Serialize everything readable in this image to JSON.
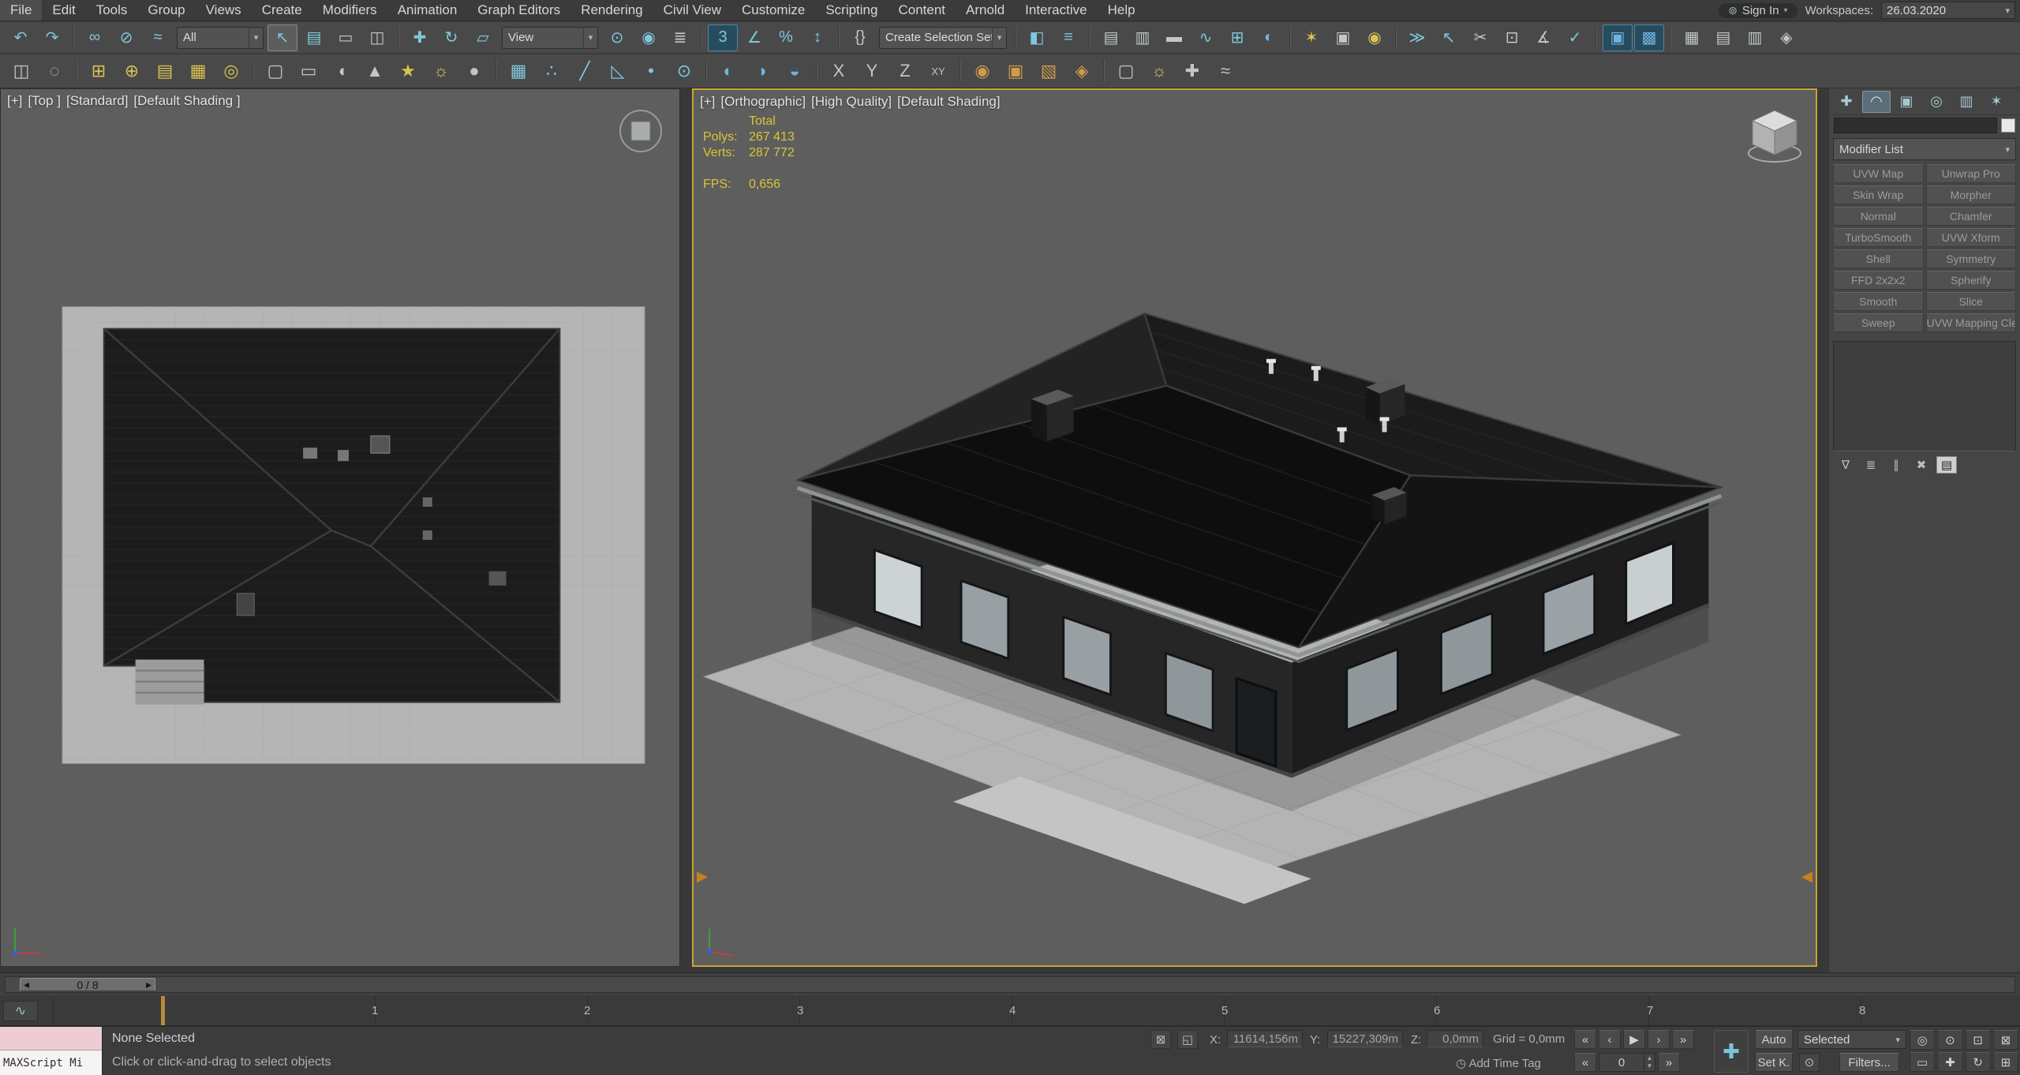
{
  "colors": {
    "active_viewport_border": "#c9a42f",
    "stats_text": "#d6c832",
    "toolbar_active_blue": "#274c5e",
    "maxscript_pink": "#edccd4"
  },
  "menu": {
    "items": [
      {
        "l": "File",
        "n": "menu-file"
      },
      {
        "l": "Edit",
        "n": "menu-edit"
      },
      {
        "l": "Tools",
        "n": "menu-tools"
      },
      {
        "l": "Group",
        "n": "menu-group"
      },
      {
        "l": "Views",
        "n": "menu-views"
      },
      {
        "l": "Create",
        "n": "menu-create"
      },
      {
        "l": "Modifiers",
        "n": "menu-modifiers"
      },
      {
        "l": "Animation",
        "n": "menu-animation"
      },
      {
        "l": "Graph Editors",
        "n": "menu-graph-editors"
      },
      {
        "l": "Rendering",
        "n": "menu-rendering"
      },
      {
        "l": "Civil View",
        "n": "menu-civil-view"
      },
      {
        "l": "Customize",
        "n": "menu-customize"
      },
      {
        "l": "Scripting",
        "n": "menu-scripting"
      },
      {
        "l": "Content",
        "n": "menu-content"
      },
      {
        "l": "Arnold",
        "n": "menu-arnold"
      },
      {
        "l": "Interactive",
        "n": "menu-interactive"
      },
      {
        "l": "Help",
        "n": "menu-help"
      }
    ],
    "sign_in": "Sign In",
    "sign_in_caret": "▾",
    "person_glyph": "⊚",
    "workspaces_label": "Workspaces:",
    "workspace_value": "26.03.2020",
    "workspace_caret": "▾"
  },
  "toolbar_row1": [
    {
      "t": "i",
      "n": "undo-icon",
      "g": "↶",
      "c": "teal"
    },
    {
      "t": "i",
      "n": "redo-icon",
      "g": "↷",
      "c": "teal"
    },
    {
      "t": "s"
    },
    {
      "t": "i",
      "n": "select-and-link-icon",
      "g": "∞",
      "c": "teal"
    },
    {
      "t": "i",
      "n": "unlink-selection-icon",
      "g": "⊘",
      "c": "teal"
    },
    {
      "t": "i",
      "n": "bind-to-space-warp-icon",
      "g": "≈",
      "c": "teal"
    },
    {
      "t": "dd",
      "n": "selection-filter-dropdown",
      "v": "All",
      "c": "dd-all"
    },
    {
      "t": "i",
      "n": "select-object-icon",
      "g": "↖",
      "c": "teal on"
    },
    {
      "t": "i",
      "n": "select-by-name-icon",
      "g": "▤",
      "c": "teal"
    },
    {
      "t": "i",
      "n": "rectangular-selection-region-icon",
      "g": "▭",
      "c": "gray"
    },
    {
      "t": "i",
      "n": "window-crossing-icon",
      "g": "◫",
      "c": "gray"
    },
    {
      "t": "s"
    },
    {
      "t": "i",
      "n": "select-and-move-icon",
      "g": "✚",
      "c": "teal"
    },
    {
      "t": "i",
      "n": "select-and-rotate-icon",
      "g": "↻",
      "c": "teal"
    },
    {
      "t": "i",
      "n": "select-and-scale-icon",
      "g": "▱",
      "c": "teal"
    },
    {
      "t": "dd",
      "n": "reference-coordinate-dropdown",
      "v": "View",
      "c": "dd-view"
    },
    {
      "t": "i",
      "n": "use-pivot-point-center-icon",
      "g": "⊙",
      "c": "teal"
    },
    {
      "t": "i",
      "n": "select-and-manipulate-icon",
      "g": "◉",
      "c": "teal"
    },
    {
      "t": "i",
      "n": "keyboard-shortcut-override-icon",
      "g": "≣",
      "c": "gray"
    },
    {
      "t": "s"
    },
    {
      "t": "i",
      "n": "snap-toggle-3d-icon",
      "g": "3",
      "c": "teal act"
    },
    {
      "t": "i",
      "n": "angle-snap-icon",
      "g": "∠",
      "c": "teal"
    },
    {
      "t": "i",
      "n": "percent-snap-icon",
      "g": "%",
      "c": "teal"
    },
    {
      "t": "i",
      "n": "spinner-snap-icon",
      "g": "↕",
      "c": "teal"
    },
    {
      "t": "s"
    },
    {
      "t": "i",
      "n": "edit-named-selection-sets-icon",
      "g": "{}",
      "c": "gray"
    },
    {
      "t": "dd",
      "n": "named-selection-set-combo",
      "v": "Create Selection Set",
      "c": "dd-sel"
    },
    {
      "t": "s"
    },
    {
      "t": "i",
      "n": "mirror-icon",
      "g": "◧",
      "c": "teal"
    },
    {
      "t": "i",
      "n": "align-icon",
      "g": "≡",
      "c": "teal"
    },
    {
      "t": "s"
    },
    {
      "t": "i",
      "n": "scene-explorer-toggle-icon",
      "g": "▤",
      "c": "gray"
    },
    {
      "t": "i",
      "n": "layer-explorer-toggle-icon",
      "g": "▥",
      "c": "gray"
    },
    {
      "t": "i",
      "n": "ribbon-toggle-icon",
      "g": "▬",
      "c": "gray"
    },
    {
      "t": "i",
      "n": "curve-editor-icon",
      "g": "∿",
      "c": "teal"
    },
    {
      "t": "i",
      "n": "schematic-view-icon",
      "g": "⊞",
      "c": "teal"
    },
    {
      "t": "i",
      "n": "material-editor-icon",
      "g": "◐",
      "c": "blue"
    },
    {
      "t": "s"
    },
    {
      "t": "i",
      "n": "render-setup-icon",
      "g": "✶",
      "c": "yellow"
    },
    {
      "t": "i",
      "n": "rendered-frame-window-icon",
      "g": "▣",
      "c": "gray"
    },
    {
      "t": "i",
      "n": "render-production-icon",
      "g": "◉",
      "c": "yellow"
    },
    {
      "t": "s"
    },
    {
      "t": "i",
      "n": "toolbar-overflow-icon",
      "g": "≫",
      "c": "teal"
    },
    {
      "t": "i",
      "n": "select-similar-icon",
      "g": "↖",
      "c": "teal"
    },
    {
      "t": "i",
      "n": "cut-geometry-icon",
      "g": "✂",
      "c": "gray"
    },
    {
      "t": "i",
      "n": "paste-icon",
      "g": "⊡",
      "c": "gray"
    },
    {
      "t": "i",
      "n": "measure-ang-icon",
      "g": "∡",
      "c": "gray"
    },
    {
      "t": "i",
      "n": "validate-icon",
      "g": "✓",
      "c": "teal"
    },
    {
      "t": "s"
    },
    {
      "t": "i",
      "n": "activeshade-viewport-icon",
      "g": "▣",
      "c": "blue act"
    },
    {
      "t": "i",
      "n": "viewport-canvas-icon",
      "g": "▩",
      "c": "blue act"
    },
    {
      "t": "s"
    },
    {
      "t": "i",
      "n": "grid-settings-icon",
      "g": "▦",
      "c": "gray"
    },
    {
      "t": "i",
      "n": "array-tool-icon",
      "g": "▤",
      "c": "gray"
    },
    {
      "t": "i",
      "n": "spacing-tool-icon",
      "g": "▥",
      "c": "gray"
    },
    {
      "t": "i",
      "n": "mcg-icon",
      "g": "◈",
      "c": "gray"
    }
  ],
  "toolbar_row2": [
    {
      "t": "i",
      "n": "viewport-layout-tabs-icon",
      "g": "◫",
      "c": "gray"
    },
    {
      "t": "i",
      "n": "show-ghosting-icon",
      "g": "◌",
      "c": "gray"
    },
    {
      "t": "s"
    },
    {
      "t": "i",
      "n": "create-layer-icon",
      "g": "⊞",
      "c": "yellow"
    },
    {
      "t": "i",
      "n": "add-selection-to-layer-icon",
      "g": "⊕",
      "c": "yellow"
    },
    {
      "t": "i",
      "n": "layer-list-icon",
      "g": "▤",
      "c": "yellow"
    },
    {
      "t": "i",
      "n": "select-objects-in-layer-icon",
      "g": "▦",
      "c": "yellow"
    },
    {
      "t": "i",
      "n": "set-current-layer-icon",
      "g": "◎",
      "c": "yellow"
    },
    {
      "t": "s"
    },
    {
      "t": "i",
      "n": "rounded-rect-primitive-icon",
      "g": "▢",
      "c": "gray"
    },
    {
      "t": "i",
      "n": "capsule-primitive-icon",
      "g": "▭",
      "c": "gray"
    },
    {
      "t": "i",
      "n": "oiltank-primitive-icon",
      "g": "◖",
      "c": "gray"
    },
    {
      "t": "i",
      "n": "cone-primitive-icon",
      "g": "▲",
      "c": "gray"
    },
    {
      "t": "i",
      "n": "star-shape-icon",
      "g": "★",
      "c": "yellow"
    },
    {
      "t": "i",
      "n": "sun-light-icon",
      "g": "☼",
      "c": "yellow"
    },
    {
      "t": "i",
      "n": "sphere-primitive-icon",
      "g": "●",
      "c": "gray"
    },
    {
      "t": "s"
    },
    {
      "t": "i",
      "n": "snap-grid-points-icon",
      "g": "▦",
      "c": "teal"
    },
    {
      "t": "i",
      "n": "snap-vertex-icon",
      "g": "∴",
      "c": "teal"
    },
    {
      "t": "i",
      "n": "snap-edge-icon",
      "g": "╱",
      "c": "teal"
    },
    {
      "t": "i",
      "n": "snap-face-icon",
      "g": "◺",
      "c": "teal"
    },
    {
      "t": "i",
      "n": "snap-midpoint-icon",
      "g": "•",
      "c": "teal"
    },
    {
      "t": "i",
      "n": "snap-pivot-icon",
      "g": "⊙",
      "c": "teal"
    },
    {
      "t": "s"
    },
    {
      "t": "i",
      "n": "render-production-shortcut-icon",
      "g": "◐",
      "c": "blue"
    },
    {
      "t": "i",
      "n": "render-iterative-icon",
      "g": "◑",
      "c": "blue"
    },
    {
      "t": "i",
      "n": "activeshade-icon",
      "g": "◒",
      "c": "blue"
    },
    {
      "t": "s"
    },
    {
      "t": "i",
      "n": "axis-x-constraint-icon",
      "g": "X",
      "c": "gray"
    },
    {
      "t": "i",
      "n": "axis-y-constraint-icon",
      "g": "Y",
      "c": "gray"
    },
    {
      "t": "i",
      "n": "axis-z-constraint-icon",
      "g": "Z",
      "c": "gray"
    },
    {
      "t": "i",
      "n": "plane-xy-constraint-icon",
      "g": "XY",
      "c": "gray sm"
    },
    {
      "t": "s"
    },
    {
      "t": "i",
      "n": "massfx-world-icon",
      "g": "◉",
      "c": "orange"
    },
    {
      "t": "i",
      "n": "rigid-body-icon",
      "g": "▣",
      "c": "orange"
    },
    {
      "t": "i",
      "n": "mcloth-icon",
      "g": "▧",
      "c": "orange"
    },
    {
      "t": "i",
      "n": "ragdoll-icon",
      "g": "◈",
      "c": "orange"
    },
    {
      "t": "s"
    },
    {
      "t": "i",
      "n": "camera-create-icon",
      "g": "▢",
      "c": "gray"
    },
    {
      "t": "i",
      "n": "light-create-icon",
      "g": "☼",
      "c": "yellow"
    },
    {
      "t": "i",
      "n": "helper-create-icon",
      "g": "✚",
      "c": "gray"
    },
    {
      "t": "i",
      "n": "space-warp-create-icon",
      "g": "≈",
      "c": "gray"
    }
  ],
  "viewports": {
    "left": {
      "label": [
        {
          "l": "[+]",
          "n": "vp-left-general-menu"
        },
        {
          "l": "[Top ]",
          "n": "vp-left-pov-menu"
        },
        {
          "l": "[Standard]",
          "n": "vp-left-renderer-menu"
        },
        {
          "l": "[Default Shading ]",
          "n": "vp-left-shading-menu"
        }
      ]
    },
    "right": {
      "label": [
        {
          "l": "[+]",
          "n": "vp-right-general-menu"
        },
        {
          "l": "[Orthographic]",
          "n": "vp-right-pov-menu"
        },
        {
          "l": "[High Quality]",
          "n": "vp-right-renderer-menu"
        },
        {
          "l": "[Default Shading]",
          "n": "vp-right-shading-menu"
        }
      ],
      "stats": {
        "total_label": "Total",
        "polys_label": "Polys:",
        "polys_value": "267 413",
        "verts_label": "Verts:",
        "verts_value": "287 772",
        "fps_label": "FPS:",
        "fps_value": "0,656"
      }
    }
  },
  "command_panel": {
    "tabs": [
      {
        "n": "tab-create",
        "g": "✚"
      },
      {
        "n": "tab-modify",
        "g": "◠",
        "c": "act"
      },
      {
        "n": "tab-hierarchy",
        "g": "▣"
      },
      {
        "n": "tab-motion",
        "g": "◎"
      },
      {
        "n": "tab-display",
        "g": "▥"
      },
      {
        "n": "tab-utilities",
        "g": "✶"
      }
    ],
    "modifier_list_label": "Modifier List",
    "modifier_list_caret": "▾",
    "modifier_buttons": [
      {
        "l": "UVW Map",
        "r": "Unwrap Pro"
      },
      {
        "l": "Skin Wrap",
        "r": "Morpher"
      },
      {
        "l": "Normal",
        "r": "Chamfer"
      },
      {
        "l": "TurboSmooth",
        "r": "UVW Xform"
      },
      {
        "l": "Shell",
        "r": "Symmetry"
      },
      {
        "l": "FFD 2x2x2",
        "r": "Spherify"
      },
      {
        "l": "Smooth",
        "r": "Slice"
      },
      {
        "l": "Sweep",
        "r": "UVW Mapping Clear"
      }
    ],
    "stack_tools": [
      {
        "n": "pin-stack-icon",
        "g": "∇"
      },
      {
        "n": "show-end-result-icon",
        "g": "≣"
      },
      {
        "n": "make-unique-icon",
        "g": "∥"
      },
      {
        "n": "remove-modifier-icon",
        "g": "✖"
      },
      {
        "n": "configure-modifier-sets-icon",
        "g": "▤",
        "c": "on"
      }
    ]
  },
  "timeline": {
    "slider_value": "0 / 8",
    "prev_glyph": "◂",
    "next_glyph": "▸",
    "mini_editor_glyph": "∿",
    "ticks": [
      "1",
      "2",
      "3",
      "4",
      "5",
      "6",
      "7",
      "8"
    ]
  },
  "status_bar": {
    "maxscript_text": "MAXScript Mi",
    "selection_status": "None Selected",
    "prompt": "Click or click-and-drag to select objects",
    "lock_glyph": "⊠",
    "absolute_mode_glyph": "◱",
    "coords": {
      "x_label": "X:",
      "x_value": "11614,156m",
      "y_label": "Y:",
      "y_value": "15227,309m",
      "z_label": "Z:",
      "z_value": "0,0mm"
    },
    "grid_label": "Grid = 0,0mm",
    "time_tag_glyph": "◷",
    "add_time_tag": "Add Time Tag",
    "playback": [
      {
        "n": "goto-start-icon",
        "g": "«"
      },
      {
        "n": "previous-frame-icon",
        "g": "‹"
      },
      {
        "n": "play-icon",
        "g": "▶"
      },
      {
        "n": "next-frame-icon",
        "g": "›"
      },
      {
        "n": "goto-end-icon",
        "g": "»"
      }
    ],
    "prev_key_glyph": "«",
    "next_key_glyph": "»",
    "frame_value": "0",
    "spin_up": "▲",
    "spin_down": "▼",
    "set_key_glyph": "✚",
    "auto_label": "Auto",
    "selected_label": "Selected",
    "selected_caret": "▾",
    "set_key_label": "Set K.",
    "key_filters_glyph": "⊙",
    "filters_label": "Filters...",
    "nav_icons": [
      {
        "n": "zoom-icon",
        "g": "◎"
      },
      {
        "n": "zoom-all-icon",
        "g": "⊙"
      },
      {
        "n": "zoom-extents-icon",
        "g": "⊡"
      },
      {
        "n": "zoom-extents-all-icon",
        "g": "⊠"
      },
      {
        "n": "zoom-region-icon",
        "g": "▭"
      },
      {
        "n": "pan-view-icon",
        "g": "✚"
      },
      {
        "n": "orbit-icon",
        "g": "↻"
      },
      {
        "n": "maximize-viewport-toggle-icon",
        "g": "⊞"
      }
    ]
  }
}
